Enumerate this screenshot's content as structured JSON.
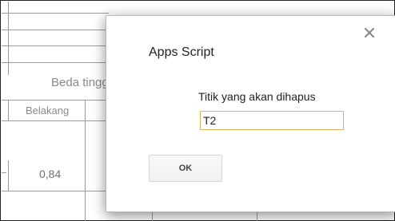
{
  "sheet": {
    "merged_header": "Beda tinggi",
    "column_header": "Belakang",
    "value": "0,84"
  },
  "dialog": {
    "title": "Apps Script",
    "close_icon": "close-icon",
    "prompt": "Titik yang akan dihapus",
    "input_value": "T2",
    "ok_label": "OK"
  }
}
